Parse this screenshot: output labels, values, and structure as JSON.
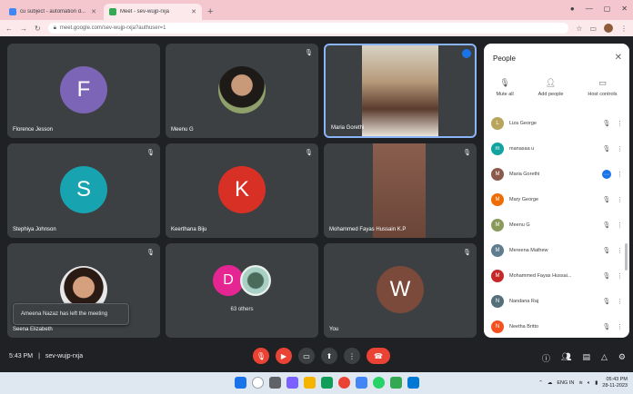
{
  "browser": {
    "tabs": [
      {
        "title": "cu subject - automation d...",
        "active": false,
        "fav_color": "#4285f4"
      },
      {
        "title": "Meet - sev-wujp-rxja",
        "active": true,
        "fav_color": "#34a853"
      }
    ],
    "url": "meet.google.com/sev-wujp-rxja?authuser=1"
  },
  "tiles": [
    {
      "name": "Florence Jesson",
      "initial": "F",
      "color": "#7c65b6",
      "muted": false
    },
    {
      "name": "Meenu G",
      "initial": "",
      "color": "#8a9a5b",
      "muted": true
    },
    {
      "name": "Maria Gorethi",
      "initial": "",
      "color": "#b59a6e",
      "muted": false
    },
    {
      "name": "Stephiya Johnson",
      "initial": "S",
      "color": "#17a3b0",
      "muted": true
    },
    {
      "name": "Keerthana Biju",
      "initial": "K",
      "color": "#d93025",
      "muted": true
    },
    {
      "name": "Mohammed Fayas Hussain K.P",
      "initial": "",
      "color": "#7a5a4a",
      "muted": true
    },
    {
      "name": "Seena Elizabeth",
      "initial": "",
      "color": "#c9a27e",
      "muted": true
    },
    {
      "name": "63 others",
      "initial": "D",
      "color": "#e52592",
      "muted": false
    },
    {
      "name": "You",
      "initial": "W",
      "color": "#7b4a3a",
      "muted": true
    }
  ],
  "toast": "Ameena Nazaz has left the meeting",
  "people_panel": {
    "title": "People",
    "actions": [
      {
        "label": "Mute all",
        "icon": "mic-off-icon"
      },
      {
        "label": "Add people",
        "icon": "add-person-icon"
      },
      {
        "label": "Host controls",
        "icon": "lock-icon"
      }
    ],
    "participants": [
      {
        "name": "Liza George",
        "initial": "L",
        "color": "#b9a45c"
      },
      {
        "name": "manasaa u",
        "initial": "m",
        "color": "#12a3a0"
      },
      {
        "name": "Maria Gorethi",
        "initial": "M",
        "color": "#8b5a4a",
        "speaking": true
      },
      {
        "name": "Mary George",
        "initial": "M",
        "color": "#ef6c00"
      },
      {
        "name": "Meenu G",
        "initial": "M",
        "color": "#8a9a5b"
      },
      {
        "name": "Mereena Mathew",
        "initial": "M",
        "color": "#5f7d8e"
      },
      {
        "name": "Mohammed Fayas Hussai...",
        "initial": "M",
        "color": "#c62828"
      },
      {
        "name": "Nandana Raj",
        "initial": "N",
        "color": "#546e7a"
      },
      {
        "name": "Neetha Britto",
        "initial": "N",
        "color": "#f4511e"
      }
    ]
  },
  "bottom": {
    "time": "5:43 PM",
    "code": "sev-wujp-rxja"
  },
  "tray": {
    "lang": "ENG IN",
    "clock": "05:43 PM",
    "date": "28-11-2023"
  }
}
